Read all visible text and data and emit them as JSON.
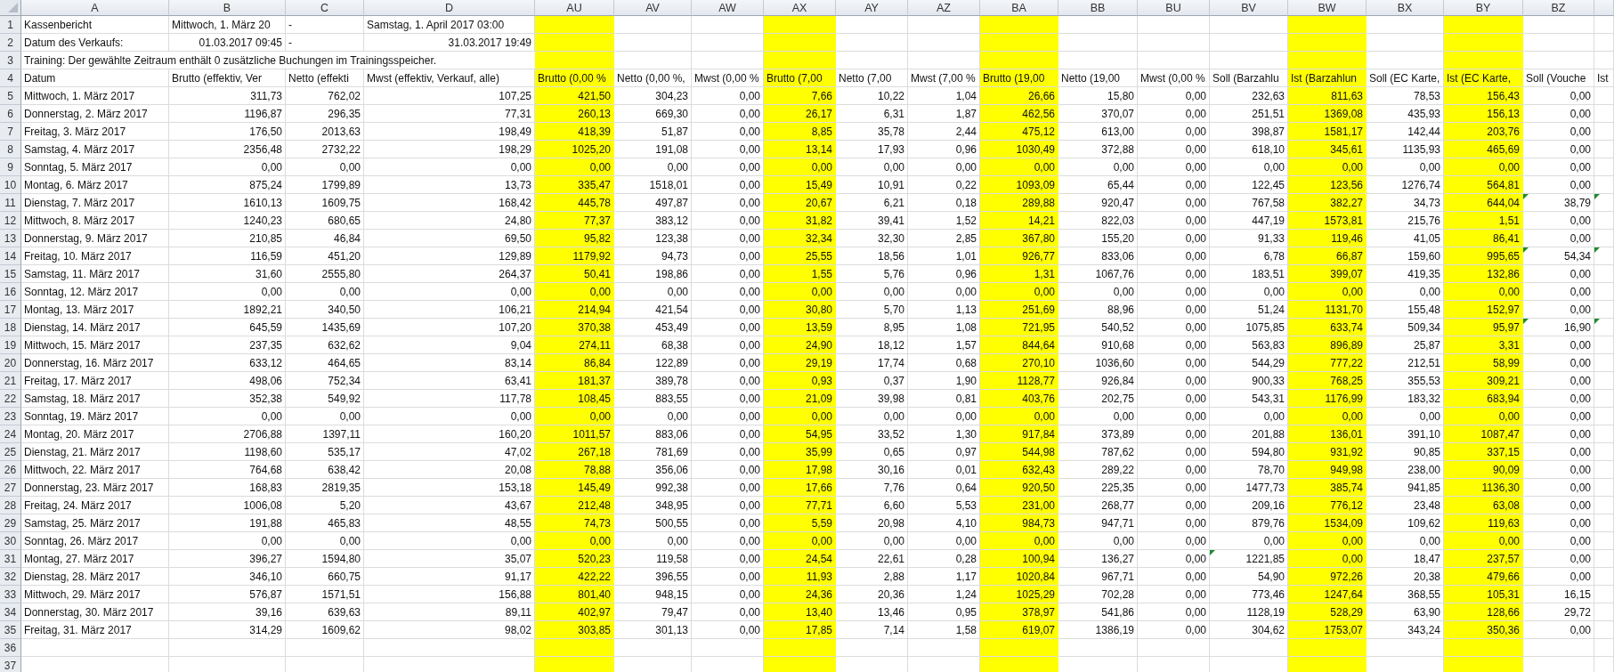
{
  "sheet": {
    "columns": [
      {
        "letter": "A",
        "highlighted": false
      },
      {
        "letter": "B",
        "highlighted": false
      },
      {
        "letter": "C",
        "highlighted": false
      },
      {
        "letter": "D",
        "highlighted": false
      },
      {
        "letter": "AU",
        "highlighted": true
      },
      {
        "letter": "AV",
        "highlighted": false
      },
      {
        "letter": "AW",
        "highlighted": false
      },
      {
        "letter": "AX",
        "highlighted": true
      },
      {
        "letter": "AY",
        "highlighted": false
      },
      {
        "letter": "AZ",
        "highlighted": false
      },
      {
        "letter": "BA",
        "highlighted": true
      },
      {
        "letter": "BB",
        "highlighted": false
      },
      {
        "letter": "BU",
        "highlighted": false
      },
      {
        "letter": "BV",
        "highlighted": false
      },
      {
        "letter": "BW",
        "highlighted": true
      },
      {
        "letter": "BX",
        "highlighted": false
      },
      {
        "letter": "BY",
        "highlighted": true
      },
      {
        "letter": "BZ",
        "highlighted": false
      },
      {
        "highlighted": false
      }
    ],
    "rows": [
      {
        "number": "1",
        "kind": "info",
        "cells": [
          "Kassenbericht",
          "Mittwoch, 1. März 20",
          "-",
          "Samstag, 1. April 2017 03:00",
          null,
          null,
          null,
          null,
          null,
          null,
          null,
          null,
          null,
          null,
          null,
          null,
          null,
          null,
          null
        ]
      },
      {
        "number": "2",
        "kind": "info",
        "cells": [
          "Datum des Verkaufs:",
          {
            "text": "01.03.2017 09:45",
            "kind": "date"
          },
          "-",
          {
            "text": "31.03.2017 19:49",
            "kind": "date"
          },
          null,
          null,
          null,
          null,
          null,
          null,
          null,
          null,
          null,
          null,
          null,
          null,
          null,
          null,
          null
        ]
      },
      {
        "number": "3",
        "kind": "note",
        "cells": [
          "Training: Der gewählte Zeitraum enthält 0 zusätzliche Buchungen im Trainingsspeicher.",
          null,
          null,
          null,
          null,
          null,
          null,
          null,
          null,
          null,
          null,
          null,
          null,
          null,
          null,
          null,
          null,
          null,
          null
        ]
      },
      {
        "number": "4",
        "kind": "header",
        "cells": [
          "Datum",
          "Brutto (effektiv, Ver",
          "Netto (effekti",
          "Mwst (effektiv, Verkauf, alle)",
          "Brutto (0,00 %",
          "Netto (0,00 %,",
          "Mwst (0,00 %",
          "Brutto (7,00",
          "Netto (7,00",
          "Mwst (7,00 %",
          "Brutto (19,00",
          "Netto (19,00",
          "Mwst (0,00 %",
          "Soll (Barzahlu",
          "Ist (Barzahlun",
          "Soll (EC Karte,",
          "Ist (EC Karte,",
          "Soll (Vouche",
          "Ist"
        ]
      },
      {
        "number": "5",
        "kind": "data",
        "cells": [
          "Mittwoch, 1. März 2017",
          "311,73",
          "762,02",
          "107,25",
          "421,50",
          "304,23",
          "0,00",
          "7,66",
          "10,22",
          "1,04",
          "26,66",
          "15,80",
          "0,00",
          "232,63",
          "811,63",
          "78,53",
          "156,43",
          "0,00",
          null
        ]
      },
      {
        "number": "6",
        "kind": "data",
        "cells": [
          "Donnerstag, 2. März 2017",
          "1196,87",
          "296,35",
          "77,31",
          "260,13",
          "669,30",
          "0,00",
          "26,17",
          "6,31",
          "1,87",
          "462,56",
          "370,07",
          "0,00",
          "251,51",
          "1369,08",
          "435,93",
          "156,13",
          "0,00",
          null
        ]
      },
      {
        "number": "7",
        "kind": "data",
        "cells": [
          "Freitag, 3. März 2017",
          "176,50",
          "2013,63",
          "198,49",
          "418,39",
          "51,87",
          "0,00",
          "8,85",
          "35,78",
          "2,44",
          "475,12",
          "613,00",
          "0,00",
          "398,87",
          "1581,17",
          "142,44",
          "203,76",
          "0,00",
          null
        ]
      },
      {
        "number": "8",
        "kind": "data",
        "cells": [
          "Samstag, 4. März 2017",
          "2356,48",
          "2732,22",
          "198,29",
          "1025,20",
          "191,08",
          "0,00",
          "13,14",
          "17,93",
          "0,96",
          "1030,49",
          "372,88",
          "0,00",
          "618,10",
          "345,61",
          "1135,93",
          "465,69",
          "0,00",
          null
        ]
      },
      {
        "number": "9",
        "kind": "data",
        "cells": [
          "Sonntag, 5. März 2017",
          "0,00",
          "0,00",
          "0,00",
          "0,00",
          "0,00",
          "0,00",
          "0,00",
          "0,00",
          "0,00",
          "0,00",
          "0,00",
          "0,00",
          "0,00",
          "0,00",
          "0,00",
          "0,00",
          "0,00",
          null
        ]
      },
      {
        "number": "10",
        "kind": "data",
        "cells": [
          "Montag, 6. März 2017",
          "875,24",
          "1799,89",
          "13,73",
          "335,47",
          "1518,01",
          "0,00",
          "15,49",
          "10,91",
          "0,22",
          "1093,09",
          "65,44",
          "0,00",
          "122,45",
          "123,56",
          "1276,74",
          "564,81",
          "0,00",
          null
        ]
      },
      {
        "number": "11",
        "kind": "data",
        "cells": [
          "Dienstag, 7. März 2017",
          "1610,13",
          "1609,75",
          "168,42",
          "445,78",
          "497,87",
          "0,00",
          "20,67",
          "6,21",
          "0,18",
          "289,88",
          "920,47",
          "0,00",
          "767,58",
          "382,27",
          "34,73",
          "644,04",
          {
            "text": "38,79",
            "error_mark": true
          },
          {
            "error_mark": true
          }
        ]
      },
      {
        "number": "12",
        "kind": "data",
        "cells": [
          "Mittwoch, 8. März 2017",
          "1240,23",
          "680,65",
          "24,80",
          "77,37",
          "383,12",
          "0,00",
          "31,82",
          "39,41",
          "1,52",
          "14,21",
          "822,03",
          "0,00",
          "447,19",
          "1573,81",
          "215,76",
          "1,51",
          "0,00",
          null
        ]
      },
      {
        "number": "13",
        "kind": "data",
        "cells": [
          "Donnerstag, 9. März 2017",
          "210,85",
          "46,84",
          "69,50",
          "95,82",
          "123,38",
          "0,00",
          "32,34",
          "32,30",
          "2,85",
          "367,80",
          "155,20",
          "0,00",
          "91,33",
          "119,46",
          "41,05",
          "86,41",
          "0,00",
          null
        ]
      },
      {
        "number": "14",
        "kind": "data",
        "cells": [
          "Freitag, 10. März 2017",
          "116,59",
          "451,20",
          "129,89",
          "1179,92",
          "94,73",
          "0,00",
          "25,55",
          "18,56",
          "1,01",
          "926,77",
          "833,06",
          "0,00",
          "6,78",
          "66,87",
          "159,60",
          "995,65",
          {
            "text": "54,34",
            "error_mark": true
          },
          {
            "error_mark": true
          }
        ]
      },
      {
        "number": "15",
        "kind": "data",
        "cells": [
          "Samstag, 11. März 2017",
          "31,60",
          "2555,80",
          "264,37",
          "50,41",
          "198,86",
          "0,00",
          "1,55",
          "5,76",
          "0,96",
          "1,31",
          "1067,76",
          "0,00",
          "183,51",
          "399,07",
          "419,35",
          "132,86",
          "0,00",
          null
        ]
      },
      {
        "number": "16",
        "kind": "data",
        "cells": [
          "Sonntag, 12. März 2017",
          "0,00",
          "0,00",
          "0,00",
          "0,00",
          "0,00",
          "0,00",
          "0,00",
          "0,00",
          "0,00",
          "0,00",
          "0,00",
          "0,00",
          "0,00",
          "0,00",
          "0,00",
          "0,00",
          "0,00",
          null
        ]
      },
      {
        "number": "17",
        "kind": "data",
        "cells": [
          "Montag, 13. März 2017",
          "1892,21",
          "340,50",
          "106,21",
          "214,94",
          "421,54",
          "0,00",
          "30,80",
          "5,70",
          "1,13",
          "251,69",
          "88,96",
          "0,00",
          "51,24",
          "1131,70",
          "155,48",
          "152,97",
          "0,00",
          null
        ]
      },
      {
        "number": "18",
        "kind": "data",
        "cells": [
          "Dienstag, 14. März 2017",
          "645,59",
          "1435,69",
          "107,20",
          "370,38",
          "453,49",
          "0,00",
          "13,59",
          "8,95",
          "1,08",
          "721,95",
          "540,52",
          "0,00",
          "1075,85",
          "633,74",
          "509,34",
          "95,97",
          {
            "text": "16,90",
            "error_mark": true
          },
          {
            "error_mark": true
          }
        ]
      },
      {
        "number": "19",
        "kind": "data",
        "cells": [
          "Mittwoch, 15. März 2017",
          "237,35",
          "632,62",
          "9,04",
          "274,11",
          "68,38",
          "0,00",
          "24,90",
          "18,12",
          "1,57",
          "844,64",
          "910,68",
          "0,00",
          "563,83",
          "896,89",
          "25,87",
          "3,31",
          "0,00",
          null
        ]
      },
      {
        "number": "20",
        "kind": "data",
        "cells": [
          "Donnerstag, 16. März 2017",
          "633,12",
          "464,65",
          "83,14",
          "86,84",
          "122,89",
          "0,00",
          "29,19",
          "17,74",
          "0,68",
          "270,10",
          "1036,60",
          "0,00",
          "544,29",
          "777,22",
          "212,51",
          "58,99",
          "0,00",
          null
        ]
      },
      {
        "number": "21",
        "kind": "data",
        "cells": [
          "Freitag, 17. März 2017",
          "498,06",
          "752,34",
          "63,41",
          "181,37",
          "389,78",
          "0,00",
          "0,93",
          "0,37",
          "1,90",
          "1128,77",
          "926,84",
          "0,00",
          "900,33",
          "768,25",
          "355,53",
          "309,21",
          "0,00",
          null
        ]
      },
      {
        "number": "22",
        "kind": "data",
        "cells": [
          "Samstag, 18. März 2017",
          "352,38",
          "549,92",
          "117,78",
          "108,45",
          "883,55",
          "0,00",
          "21,09",
          "39,98",
          "0,81",
          "403,76",
          "202,75",
          "0,00",
          "543,31",
          "1176,99",
          "183,32",
          "683,94",
          "0,00",
          null
        ]
      },
      {
        "number": "23",
        "kind": "data",
        "cells": [
          "Sonntag, 19. März 2017",
          "0,00",
          "0,00",
          "0,00",
          "0,00",
          "0,00",
          "0,00",
          "0,00",
          "0,00",
          "0,00",
          "0,00",
          "0,00",
          "0,00",
          "0,00",
          "0,00",
          "0,00",
          "0,00",
          "0,00",
          null
        ]
      },
      {
        "number": "24",
        "kind": "data",
        "cells": [
          "Montag, 20. März 2017",
          "2706,88",
          "1397,11",
          "160,20",
          "1011,57",
          "883,06",
          "0,00",
          "54,95",
          "33,52",
          "1,30",
          "917,84",
          "373,89",
          "0,00",
          "201,88",
          "136,01",
          "391,10",
          "1087,47",
          "0,00",
          null
        ]
      },
      {
        "number": "25",
        "kind": "data",
        "cells": [
          "Dienstag, 21. März 2017",
          "1198,60",
          "535,17",
          "47,02",
          "267,18",
          "781,69",
          "0,00",
          "35,99",
          "0,65",
          "0,97",
          "544,98",
          "787,62",
          "0,00",
          "594,80",
          "931,92",
          "90,85",
          "337,15",
          "0,00",
          null
        ]
      },
      {
        "number": "26",
        "kind": "data",
        "cells": [
          "Mittwoch, 22. März 2017",
          "764,68",
          "638,42",
          "20,08",
          "78,88",
          "356,06",
          "0,00",
          "17,98",
          "30,16",
          "0,01",
          "632,43",
          "289,22",
          "0,00",
          "78,70",
          "949,98",
          "238,00",
          "90,09",
          "0,00",
          null
        ]
      },
      {
        "number": "27",
        "kind": "data",
        "cells": [
          "Donnerstag, 23. März 2017",
          "168,83",
          "2819,35",
          "153,18",
          "145,49",
          "992,38",
          "0,00",
          "17,66",
          "7,76",
          "0,64",
          "920,50",
          "225,35",
          "0,00",
          "1477,73",
          "385,74",
          "941,85",
          "1136,30",
          "0,00",
          null
        ]
      },
      {
        "number": "28",
        "kind": "data",
        "cells": [
          "Freitag, 24. März 2017",
          "1006,08",
          "5,20",
          "43,67",
          "212,48",
          "348,95",
          "0,00",
          "77,71",
          "6,60",
          "5,53",
          "231,00",
          "268,77",
          "0,00",
          "209,16",
          "776,12",
          "23,48",
          "63,08",
          "0,00",
          null
        ]
      },
      {
        "number": "29",
        "kind": "data",
        "cells": [
          "Samstag, 25. März 2017",
          "191,88",
          "465,83",
          "48,55",
          "74,73",
          "500,55",
          "0,00",
          "5,59",
          "20,98",
          "4,10",
          "984,73",
          "947,71",
          "0,00",
          "879,76",
          "1534,09",
          "109,62",
          "119,63",
          "0,00",
          null
        ]
      },
      {
        "number": "30",
        "kind": "data",
        "cells": [
          "Sonntag, 26. März 2017",
          "0,00",
          "0,00",
          "0,00",
          "0,00",
          "0,00",
          "0,00",
          "0,00",
          "0,00",
          "0,00",
          "0,00",
          "0,00",
          "0,00",
          "0,00",
          "0,00",
          "0,00",
          "0,00",
          "0,00",
          null
        ]
      },
      {
        "number": "31",
        "kind": "data",
        "cells": [
          "Montag, 27. März 2017",
          "396,27",
          "1594,80",
          "35,07",
          "520,23",
          "119,58",
          "0,00",
          "24,54",
          "22,61",
          "0,28",
          "100,94",
          "136,27",
          "0,00",
          {
            "text": "1221,85",
            "error_mark": true
          },
          "0,00",
          "18,47",
          "237,57",
          "0,00",
          null
        ]
      },
      {
        "number": "32",
        "kind": "data",
        "cells": [
          "Dienstag, 28. März 2017",
          "346,10",
          "660,75",
          "91,17",
          "422,22",
          "396,55",
          "0,00",
          "11,93",
          "2,88",
          "1,17",
          "1020,84",
          "967,71",
          "0,00",
          "54,90",
          "972,26",
          "20,38",
          "479,66",
          "0,00",
          null
        ]
      },
      {
        "number": "33",
        "kind": "data",
        "cells": [
          "Mittwoch, 29. März 2017",
          "576,87",
          "1571,51",
          "156,88",
          "801,40",
          "948,15",
          "0,00",
          "24,36",
          "20,36",
          "1,24",
          "1025,29",
          "702,28",
          "0,00",
          "773,46",
          "1247,64",
          "368,55",
          "105,31",
          "16,15",
          null
        ]
      },
      {
        "number": "34",
        "kind": "data",
        "cells": [
          "Donnerstag, 30. März 2017",
          "39,16",
          "639,63",
          "89,11",
          "402,97",
          "79,47",
          "0,00",
          "13,40",
          "13,46",
          "0,95",
          "378,97",
          "541,86",
          "0,00",
          "1128,19",
          "528,29",
          "63,90",
          "128,66",
          "29,72",
          null
        ]
      },
      {
        "number": "35",
        "kind": "data",
        "cells": [
          "Freitag, 31. März 2017",
          "314,29",
          "1609,62",
          "98,02",
          "303,85",
          "301,13",
          "0,00",
          "17,85",
          "7,14",
          "1,58",
          "619,07",
          "1386,19",
          "0,00",
          "304,62",
          "1753,07",
          "343,24",
          "350,36",
          "0,00",
          null
        ]
      },
      {
        "number": "36",
        "kind": "empty",
        "cells": []
      },
      {
        "number": "37",
        "kind": "empty",
        "cells": []
      }
    ]
  }
}
